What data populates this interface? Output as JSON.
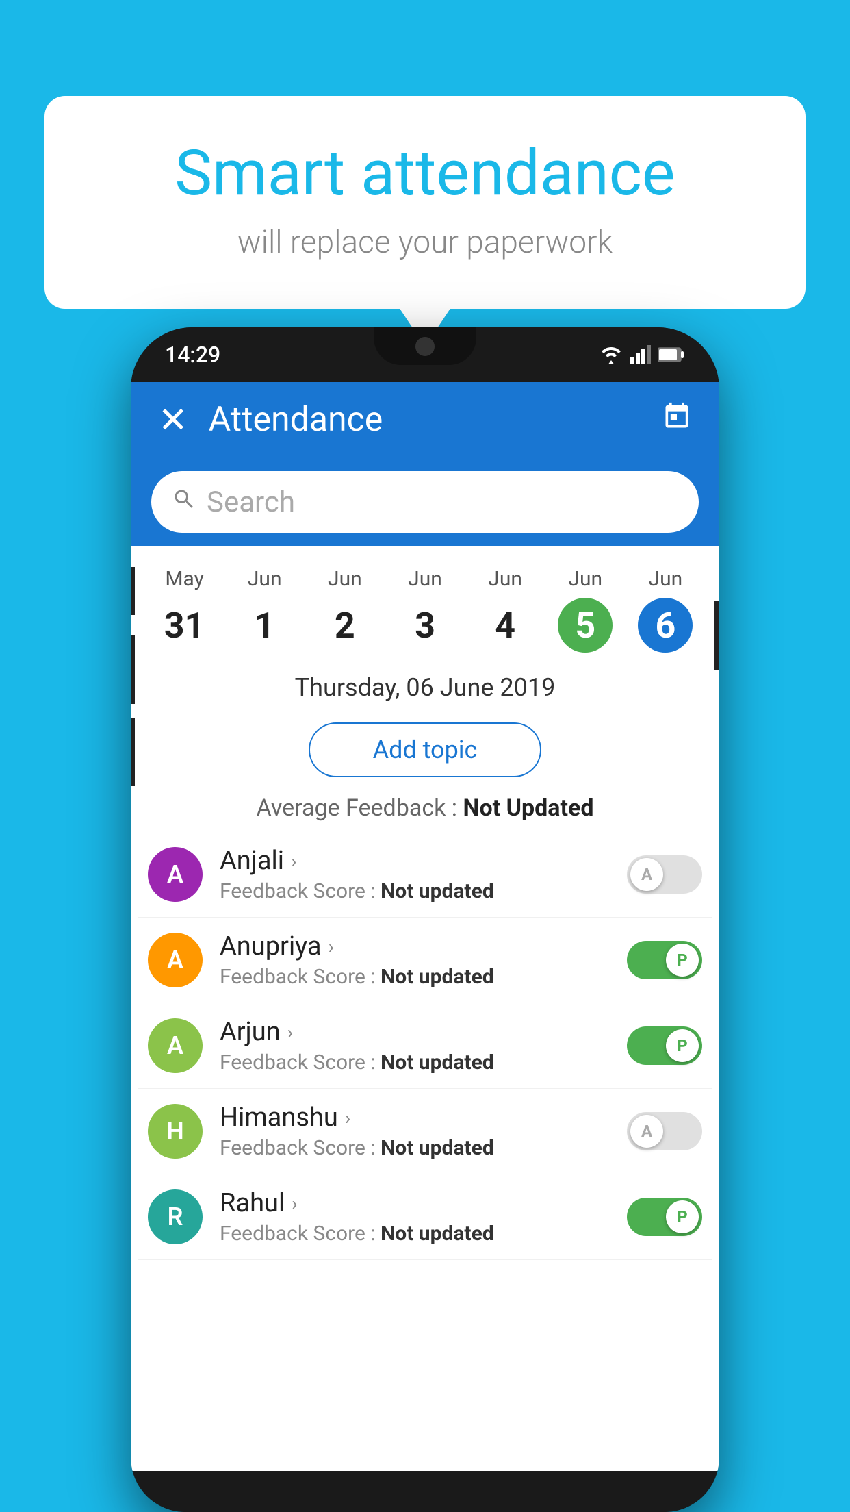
{
  "background_color": "#1ab8e8",
  "speech_bubble": {
    "title": "Smart attendance",
    "subtitle": "will replace your paperwork"
  },
  "status_bar": {
    "time": "14:29"
  },
  "app_bar": {
    "title": "Attendance",
    "close_icon": "✕"
  },
  "search": {
    "placeholder": "Search"
  },
  "calendar": {
    "dates": [
      {
        "month": "May",
        "day": "31",
        "style": ""
      },
      {
        "month": "Jun",
        "day": "1",
        "style": ""
      },
      {
        "month": "Jun",
        "day": "2",
        "style": ""
      },
      {
        "month": "Jun",
        "day": "3",
        "style": ""
      },
      {
        "month": "Jun",
        "day": "4",
        "style": ""
      },
      {
        "month": "Jun",
        "day": "5",
        "style": "green"
      },
      {
        "month": "Jun",
        "day": "6",
        "style": "blue"
      }
    ]
  },
  "selected_date": "Thursday, 06 June 2019",
  "add_topic_label": "Add topic",
  "avg_feedback_label": "Average Feedback : ",
  "avg_feedback_value": "Not Updated",
  "students": [
    {
      "name": "Anjali",
      "initial": "A",
      "avatar_color": "#9c27b0",
      "feedback": "Feedback Score : ",
      "feedback_value": "Not updated",
      "toggle": "off",
      "toggle_letter": "A"
    },
    {
      "name": "Anupriya",
      "initial": "A",
      "avatar_color": "#ff9800",
      "feedback": "Feedback Score : ",
      "feedback_value": "Not updated",
      "toggle": "on",
      "toggle_letter": "P"
    },
    {
      "name": "Arjun",
      "initial": "A",
      "avatar_color": "#8bc34a",
      "feedback": "Feedback Score : ",
      "feedback_value": "Not updated",
      "toggle": "on",
      "toggle_letter": "P"
    },
    {
      "name": "Himanshu",
      "initial": "H",
      "avatar_color": "#8bc34a",
      "feedback": "Feedback Score : ",
      "feedback_value": "Not updated",
      "toggle": "off",
      "toggle_letter": "A"
    },
    {
      "name": "Rahul",
      "initial": "R",
      "avatar_color": "#26a69a",
      "feedback": "Feedback Score : ",
      "feedback_value": "Not updated",
      "toggle": "on",
      "toggle_letter": "P"
    }
  ]
}
